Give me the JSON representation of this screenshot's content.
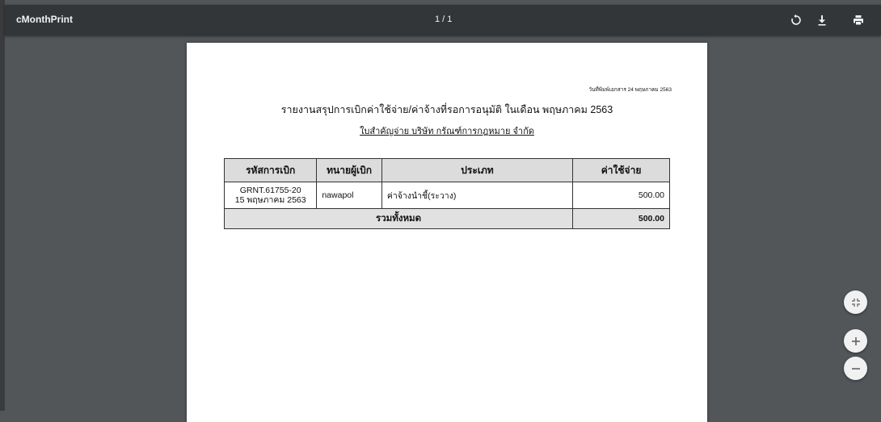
{
  "app": {
    "title": "cMonthPrint",
    "page_indicator": "1 / 1"
  },
  "toolbar": {
    "icons": [
      "rotate-icon",
      "download-icon",
      "print-icon"
    ]
  },
  "document": {
    "print_date": "วันที่พิมพ์เอกสาร 24 พฤษภาคม 2563",
    "title": "รายงานสรุปการเบิกค่าใช้จ่าย/ค่าจ้างที่รอการอนุมัติ ในเดือน พฤษภาคม 2563",
    "subtitle": "ใบสำคัญจ่าย บริษัท กรัณฑ์การกฎหมาย จำกัด",
    "table": {
      "headers": [
        "รหัสการเบิก",
        "ทนายผู้เบิก",
        "ประเภท",
        "ค่าใช้จ่าย"
      ],
      "rows": [
        {
          "code": "GRNT.61755-20",
          "date": "15 พฤษภาคม 2563",
          "lawyer": "nawapol",
          "type": "ค่าจ้างนำชี้(ระวาง)",
          "amount": "500.00"
        }
      ],
      "total_label": "รวมทั้งหมด",
      "total_amount": "500.00"
    }
  },
  "zoom_controls": {
    "icons": [
      "fit-page-icon",
      "zoom-in-icon",
      "zoom-out-icon"
    ]
  },
  "colors": {
    "viewer_background": "#525659",
    "toolbar": "#323639",
    "paper": "#ffffff",
    "header_cell": "#dcdcdc"
  }
}
